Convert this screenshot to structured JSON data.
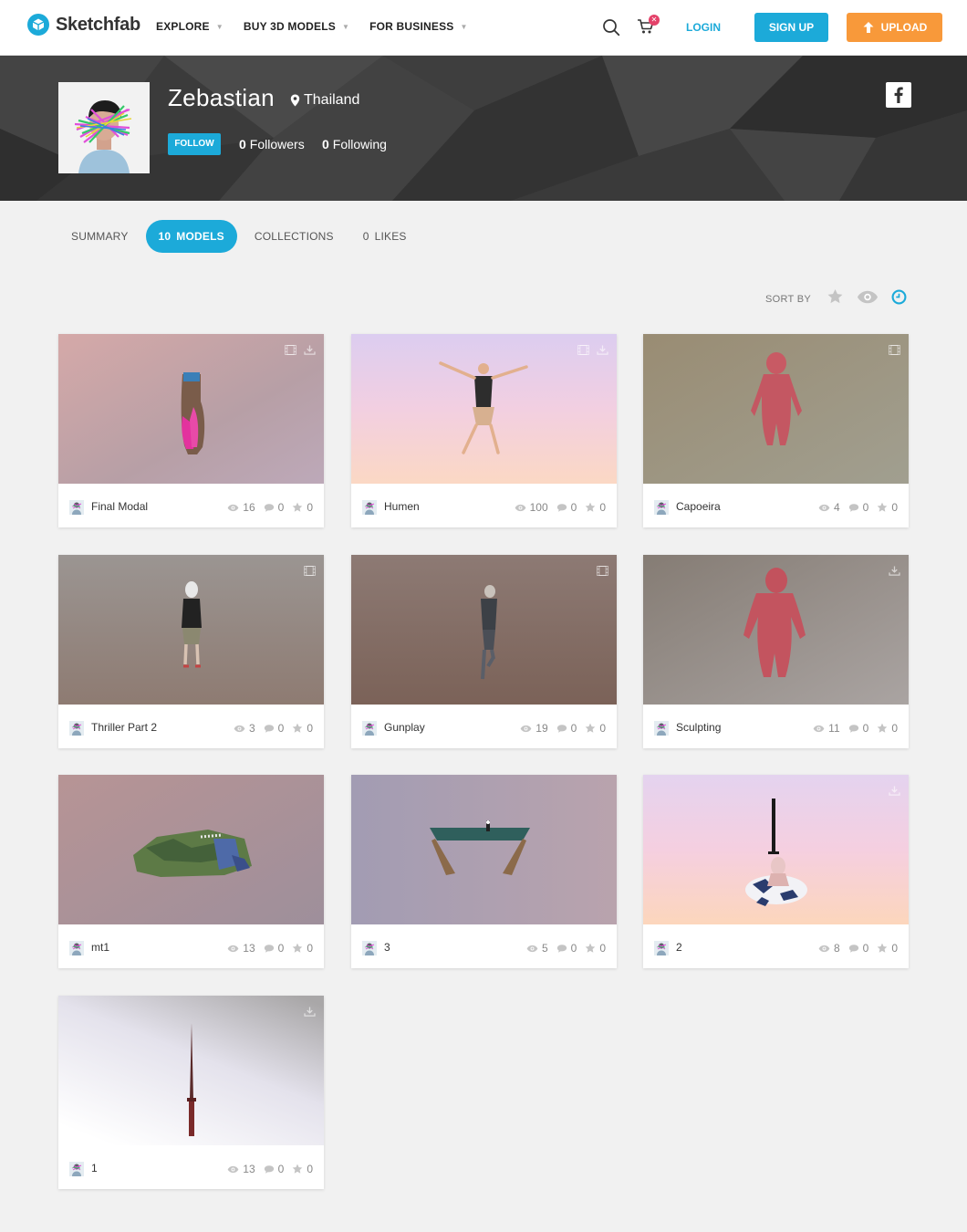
{
  "brand": {
    "name": "Sketchfab",
    "accent": "#1caad9",
    "upload_color": "#f8993a"
  },
  "nav": [
    {
      "label": "EXPLORE"
    },
    {
      "label": "BUY 3D MODELS"
    },
    {
      "label": "FOR BUSINESS"
    }
  ],
  "header": {
    "login": "LOGIN",
    "signup": "SIGN UP",
    "upload": "UPLOAD"
  },
  "profile": {
    "name": "Zebastian",
    "location": "Thailand",
    "follow": "FOLLOW",
    "followers_count": "0",
    "followers_label": "Followers",
    "following_count": "0",
    "following_label": "Following"
  },
  "tabs": [
    {
      "count": "",
      "label": "SUMMARY"
    },
    {
      "count": "10",
      "label": "MODELS"
    },
    {
      "count": "",
      "label": "COLLECTIONS"
    },
    {
      "count": "0",
      "label": "LIKES"
    }
  ],
  "sort": {
    "label": "SORT BY"
  },
  "models": [
    {
      "name": "Final Modal",
      "views": "16",
      "comments": "0",
      "likes": "0"
    },
    {
      "name": "Humen",
      "views": "100",
      "comments": "0",
      "likes": "0"
    },
    {
      "name": "Capoeira",
      "views": "4",
      "comments": "0",
      "likes": "0"
    },
    {
      "name": "Thriller Part 2",
      "views": "3",
      "comments": "0",
      "likes": "0"
    },
    {
      "name": "Gunplay",
      "views": "19",
      "comments": "0",
      "likes": "0"
    },
    {
      "name": "Sculpting",
      "views": "11",
      "comments": "0",
      "likes": "0"
    },
    {
      "name": "mt1",
      "views": "13",
      "comments": "0",
      "likes": "0"
    },
    {
      "name": "3",
      "views": "5",
      "comments": "0",
      "likes": "0"
    },
    {
      "name": "2",
      "views": "8",
      "comments": "0",
      "likes": "0"
    },
    {
      "name": "1",
      "views": "13",
      "comments": "0",
      "likes": "0"
    }
  ]
}
